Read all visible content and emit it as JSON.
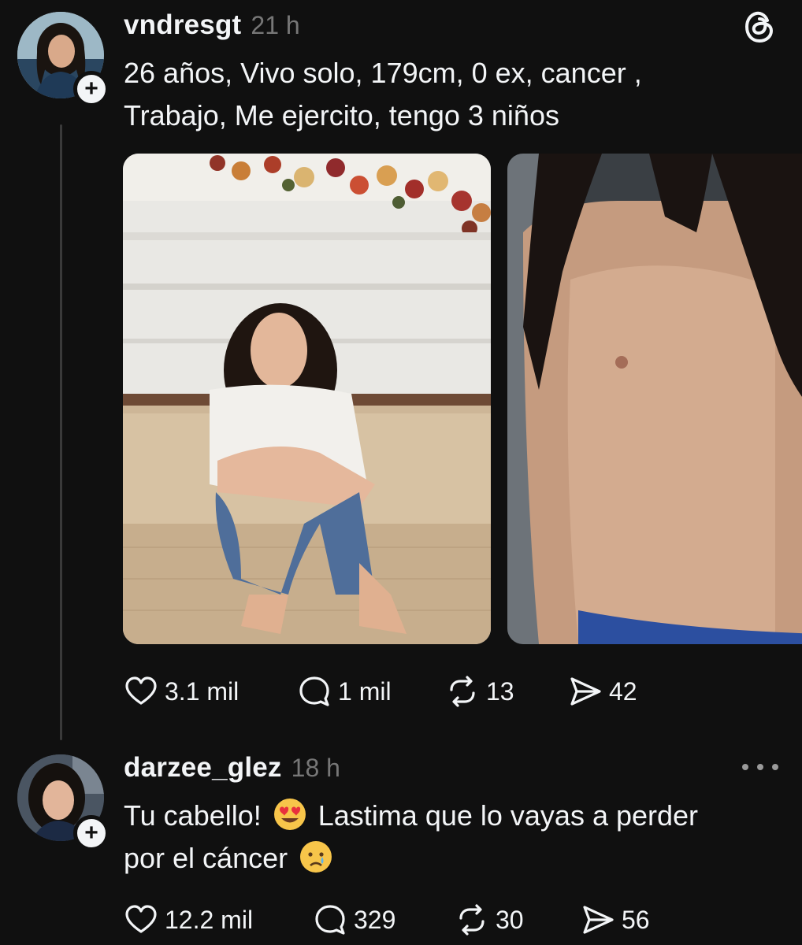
{
  "post": {
    "username": "vndresgt",
    "timestamp": "21 h",
    "text_line1": "26 años, Vivo solo, 179cm, 0 ex, cancer ,",
    "text_line2": "Trabajo, Me ejercito, tengo 3 niños",
    "icons": {
      "app": "threads-logo-icon",
      "follow": "plus-icon"
    },
    "media": [
      "photo-man-sitting-on-sofa",
      "photo-shirtless-torso"
    ],
    "stats": {
      "likes": "3.1 mil",
      "replies": "1 mil",
      "reposts": "13",
      "shares": "42"
    }
  },
  "reply": {
    "username": "darzee_glez",
    "timestamp": "18 h",
    "text_part1": "Tu cabello! ",
    "text_part2": " Lastima que lo vayas a perder",
    "text_part3": "por el cáncer ",
    "emojis": [
      "heart-eyes-emoji",
      "crying-face-emoji"
    ],
    "icons": {
      "more": "more-horizontal-icon",
      "follow": "plus-icon"
    },
    "stats": {
      "likes": "12.2 mil",
      "replies": "329",
      "reposts": "30",
      "shares": "56"
    }
  },
  "colors": {
    "background": "#101010",
    "text": "#f3f5f7",
    "muted": "#777777",
    "thread_line": "#3a3a3a"
  }
}
